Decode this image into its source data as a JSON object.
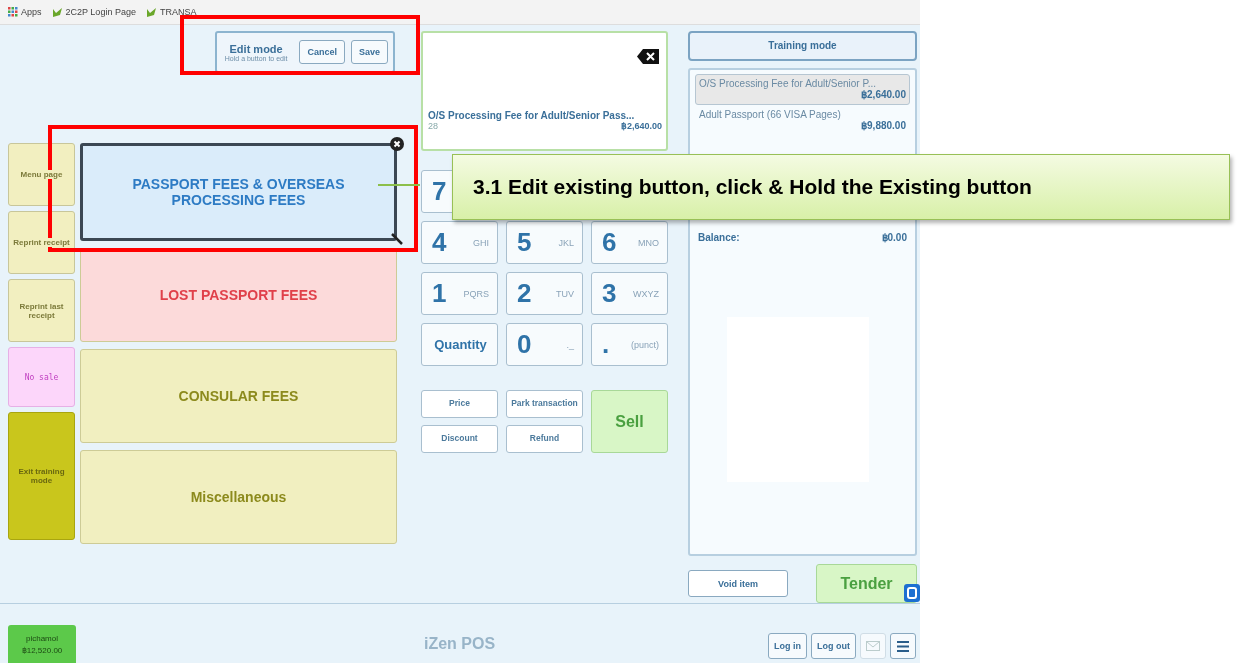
{
  "bookmarks": [
    {
      "label": "Apps",
      "kind": "apps"
    },
    {
      "label": "2C2P Login Page",
      "kind": "site"
    },
    {
      "label": "TRANSA",
      "kind": "site"
    }
  ],
  "edit_mode": {
    "title": "Edit mode",
    "hint": "Hold a button to edit",
    "buttons": [
      "Cancel",
      "Save"
    ]
  },
  "side_buttons": [
    {
      "label": "Menu page",
      "color": "#f2efc0"
    },
    {
      "label": "Reprint receipt",
      "color": "#f2efc0"
    },
    {
      "label": "Reprint last receipt",
      "color": "#f2efc0"
    },
    {
      "label": "No sale",
      "color": "#fcd6fa"
    },
    {
      "label": "Exit training mode",
      "color": "#c9c61c"
    }
  ],
  "categories": [
    {
      "label": "PASSPORT FEES & OVERSEAS PROCESSING FEES",
      "color": "#daecfa",
      "selected": true
    },
    {
      "label": "LOST PASSPORT FEES",
      "color": "#fcdada",
      "selected": false
    },
    {
      "label": "CONSULAR FEES",
      "color": "#f1efc0",
      "selected": false
    },
    {
      "label": "Miscellaneous",
      "color": "#f1efc0",
      "selected": false
    }
  ],
  "display": {
    "item": "O/S Processing Fee for Adult/Senior Pass...",
    "code": "28",
    "price": "฿2,640.00"
  },
  "keypad": [
    [
      {
        "kind": "digit",
        "digit": "7"
      }
    ],
    [
      {
        "kind": "digit",
        "digit": "4",
        "letters": "GHI"
      },
      {
        "kind": "digit",
        "digit": "5",
        "letters": "JKL"
      },
      {
        "kind": "digit",
        "digit": "6",
        "letters": "MNO"
      }
    ],
    [
      {
        "kind": "digit",
        "digit": "1",
        "letters": "PQRS"
      },
      {
        "kind": "digit",
        "digit": "2",
        "letters": "TUV"
      },
      {
        "kind": "digit",
        "digit": "3",
        "letters": "WXYZ"
      }
    ],
    [
      {
        "kind": "word",
        "label": "Quantity"
      },
      {
        "kind": "digit",
        "digit": "0",
        "letters": "._"
      },
      {
        "kind": "digit",
        "digit": ".",
        "letters": "(punct)"
      }
    ]
  ],
  "functions": [
    "Price",
    "Park transaction",
    "Discount",
    "Refund"
  ],
  "sell": "Sell",
  "receipt": {
    "title": "Training mode",
    "lines": [
      {
        "name": "O/S Processing Fee for Adult/Senior P...",
        "price": "฿2,640.00",
        "selected": true
      },
      {
        "name": "Adult Passport (66 VISA Pages)",
        "price": "฿9,880.00",
        "selected": false
      }
    ],
    "balance_label": "Balance:",
    "balance": "฿0.00"
  },
  "void_item": "Void item",
  "tender": "Tender",
  "footer": {
    "user": "pichamol",
    "amount": "฿12,520.00",
    "app_name": "iZen POS",
    "buttons": [
      "Log in",
      "Log out"
    ]
  },
  "callout": "3.1 Edit existing button, click & Hold the Existing button"
}
